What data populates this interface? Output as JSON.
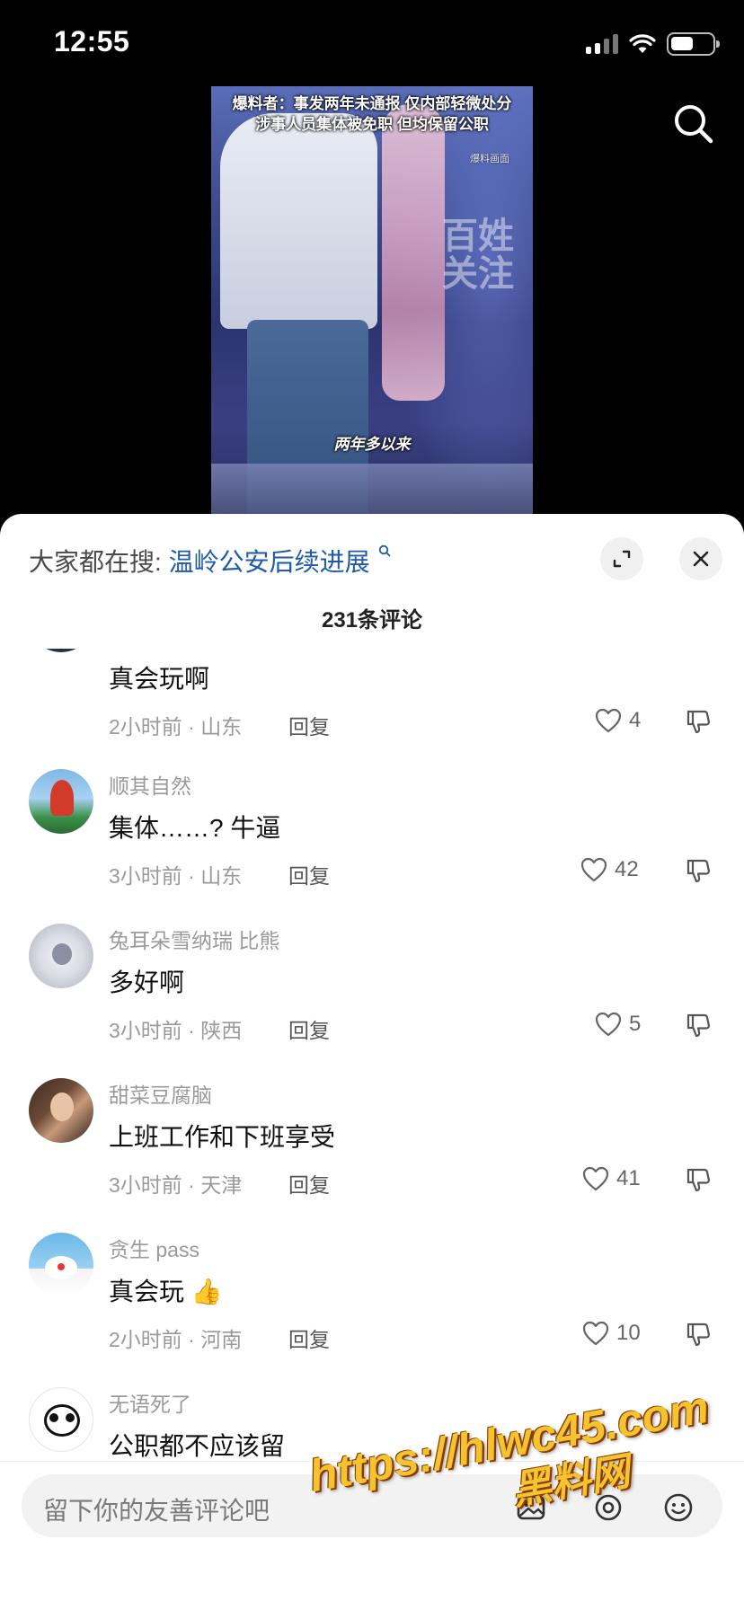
{
  "status_bar": {
    "time": "12:55",
    "battery_level": 0.55
  },
  "video": {
    "caption_line1": "爆料者：事发两年未通报 仅内部轻微处分",
    "caption_line2": "涉事人员集体被免职 但均保留公职",
    "source_label": "爆料画面",
    "watermark": "百姓关注",
    "subtitle": "两年多以来"
  },
  "hot_search": {
    "prefix": "大家都在搜:",
    "term": "温岭公安后续进展"
  },
  "comment_count": "231条评论",
  "comments": [
    {
      "username": "",
      "text": "真会玩啊",
      "time_location": "2小时前 · 山东",
      "reply": "回复",
      "likes": "4",
      "avatar": "dark-avatar"
    },
    {
      "username": "顺其自然",
      "text": "集体……?  牛逼",
      "time_location": "3小时前 · 山东",
      "reply": "回复",
      "likes": "42",
      "avatar": "red-sculpture-avatar"
    },
    {
      "username": "兔耳朵雪纳瑞 比熊",
      "text": "多好啊",
      "time_location": "3小时前 · 陕西",
      "reply": "回复",
      "likes": "5",
      "avatar": "puppy-avatar"
    },
    {
      "username": "甜菜豆腐脑",
      "text": "上班工作和下班享受",
      "time_location": "3小时前 · 天津",
      "reply": "回复",
      "likes": "41",
      "avatar": "woman-avatar"
    },
    {
      "username": "贪生 pass",
      "text": "真会玩 👍",
      "time_location": "2小时前 · 河南",
      "reply": "回复",
      "likes": "10",
      "avatar": "doraemon-avatar"
    },
    {
      "username": "无语死了",
      "text": "公职都不应该留",
      "time_location": "",
      "reply": "",
      "likes": "",
      "avatar": "panda-avatar"
    }
  ],
  "input": {
    "placeholder": "留下你的友善评论吧"
  },
  "promo_watermark": {
    "line1": "https://hlwc45.com",
    "line2": "黑料网"
  },
  "colors": {
    "link_blue": "#1f5ba8",
    "promo_yellow": "#f4c430"
  }
}
